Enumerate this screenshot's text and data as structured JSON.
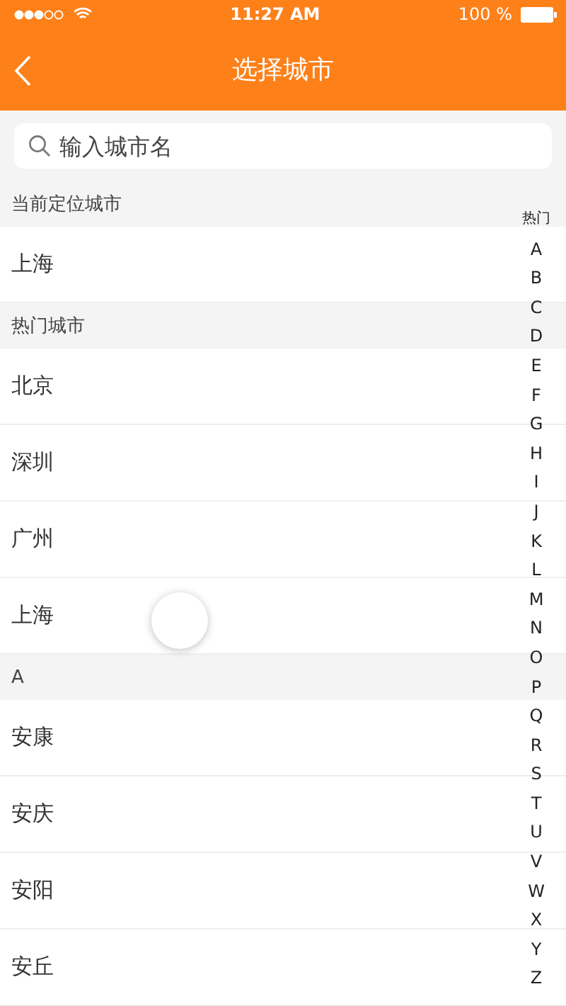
{
  "status_bar": {
    "time": "11:27 AM",
    "battery": "100 %"
  },
  "nav": {
    "title": "选择城市"
  },
  "search": {
    "placeholder": "输入城市名"
  },
  "sections": [
    {
      "title": "当前定位城市",
      "cities": [
        "上海"
      ]
    },
    {
      "title": "热门城市",
      "cities": [
        "北京",
        "深圳",
        "广州",
        "上海"
      ]
    },
    {
      "title": "A",
      "cities": [
        "安康",
        "安庆",
        "安阳",
        "安丘"
      ]
    }
  ],
  "index": [
    "热门",
    "A",
    "B",
    "C",
    "D",
    "E",
    "F",
    "G",
    "H",
    "I",
    "J",
    "K",
    "L",
    "M",
    "N",
    "O",
    "P",
    "Q",
    "R",
    "S",
    "T",
    "U",
    "V",
    "W",
    "X",
    "Y",
    "Z"
  ]
}
